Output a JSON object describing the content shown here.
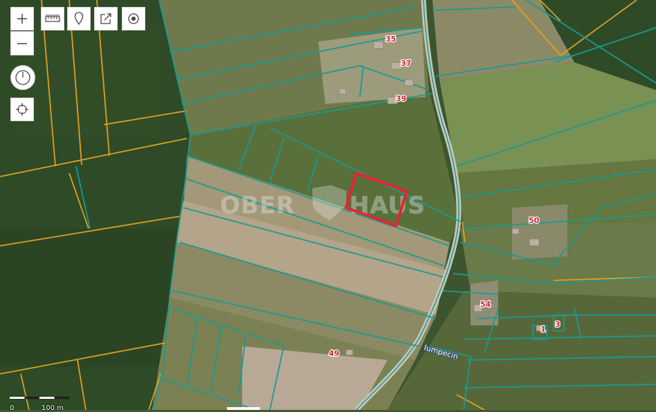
{
  "map": {
    "watermark": {
      "left": "OBER",
      "right": "HAUS"
    },
    "parcel_labels": [
      "35",
      "37",
      "39",
      "50",
      "54",
      "1",
      "3",
      "49"
    ],
    "road_label": "Iumpeciņ",
    "highlight_color": "#e8232f",
    "parcel_line_color": "#1a9a92",
    "boundary_line_color": "#e0a020"
  },
  "toolbar": {
    "zoom_in_icon": "plus-icon",
    "zoom_out_icon": "minus-icon",
    "measure_icon": "ruler-icon",
    "marker_icon": "pin-icon",
    "share_icon": "share-icon",
    "target_icon": "target-icon",
    "power_icon": "power-icon",
    "locate_icon": "crosshair-icon"
  },
  "scale": {
    "start": "0",
    "end": "100 m"
  }
}
